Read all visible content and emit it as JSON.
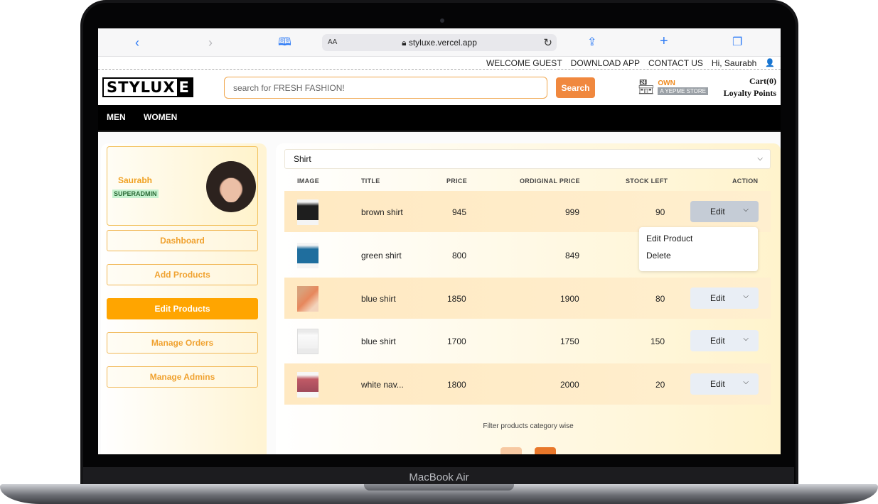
{
  "device": {
    "label": "MacBook Air"
  },
  "browser": {
    "url": "styluxe.vercel.app",
    "text_size_label": "AA",
    "icons": [
      "back-chevron-icon",
      "forward-chevron-icon",
      "bookmarks-icon",
      "lock-icon",
      "reload-icon",
      "share-icon",
      "new-tab-icon",
      "tabs-icon"
    ]
  },
  "top_links": {
    "welcome": "WELCOME GUEST",
    "download": "DOWNLOAD APP",
    "contact": "CONTACT US",
    "greeting": "Hi, Saurabh"
  },
  "header": {
    "logo_main": "STYLUX",
    "logo_e": "E",
    "search_placeholder": "search for FRESH FASHION!",
    "search_button": "Search",
    "store_own": "OWN",
    "store_label": "A YEPME STORE",
    "cart": "Cart(0)",
    "loyalty": "Loyalty Points"
  },
  "nav": {
    "men": "MEN",
    "women": "WOMEN"
  },
  "profile": {
    "name": "Saurabh",
    "role": "SUPERADMIN"
  },
  "sidebar": {
    "items": [
      {
        "label": "Dashboard",
        "active": false
      },
      {
        "label": "Add Products",
        "active": false
      },
      {
        "label": "Edit Products",
        "active": true
      },
      {
        "label": "Manage Orders",
        "active": false
      },
      {
        "label": "Manage Admins",
        "active": false
      }
    ]
  },
  "category_select": {
    "value": "Shirt"
  },
  "table": {
    "headers": {
      "image": "IMAGE",
      "title": "TITLE",
      "price": "PRICE",
      "original_price": "ORDIGINAL PRICE",
      "stock": "STOCK LEFT",
      "action": "ACTION"
    },
    "edit_label": "Edit",
    "rows": [
      {
        "title": "brown shirt",
        "price": "945",
        "original_price": "999",
        "stock": "90"
      },
      {
        "title": "green shirt",
        "price": "800",
        "original_price": "849",
        "stock": ""
      },
      {
        "title": "blue shirt",
        "price": "1850",
        "original_price": "1900",
        "stock": "80"
      },
      {
        "title": "blue shirt",
        "price": "1700",
        "original_price": "1750",
        "stock": "150"
      },
      {
        "title": "white nav...",
        "price": "1800",
        "original_price": "2000",
        "stock": "20"
      }
    ]
  },
  "action_menu": {
    "edit": "Edit Product",
    "delete": "Delete"
  },
  "caption": "Filter products category wise",
  "colors": {
    "accent": "#ffa500",
    "search_button": "#f0883e",
    "nav_bg": "#000000"
  }
}
